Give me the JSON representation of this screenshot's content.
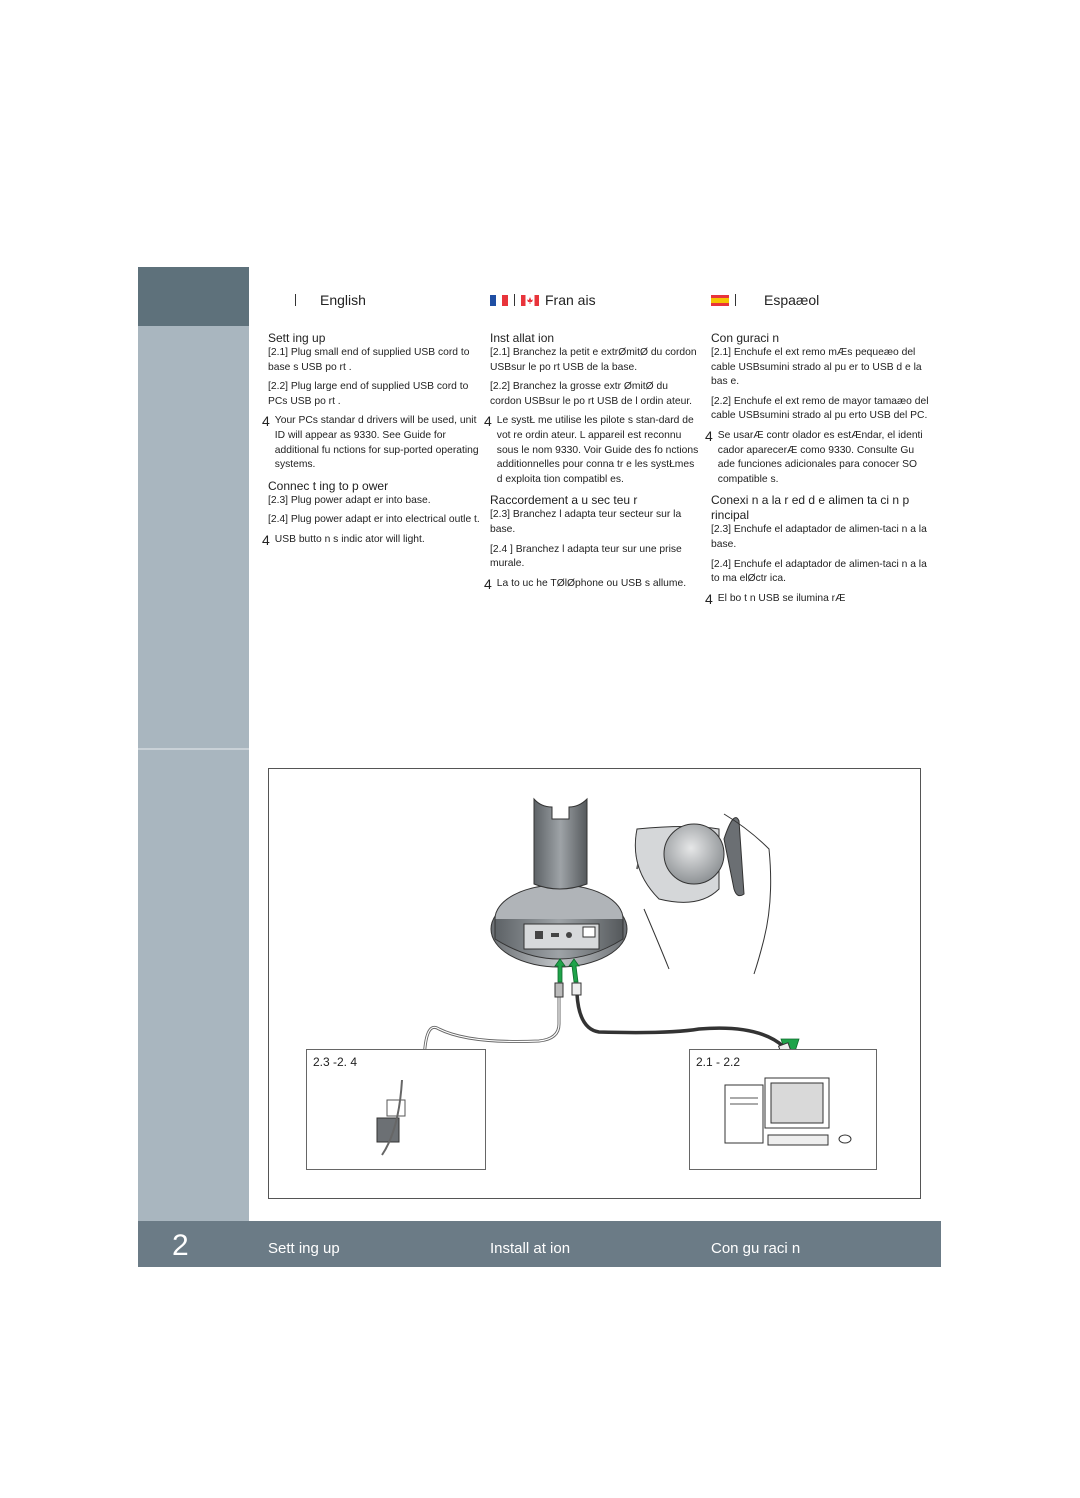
{
  "page_number": "2",
  "columns": {
    "en": {
      "language": "English",
      "section1_title": "Sett ing up",
      "step_2_1": "[2.1]  Plug small end of supplied USB cord to base s USB po rt .",
      "step_2_2": "[2.2]  Plug large end of supplied USB cord to PCs USB po rt .",
      "note1": "Your PCs standar d drivers will be used, unit ID will appear as 9330. See Guide for additional fu nctions for sup-ported operating systems.",
      "section2_title": "Connec t ing to p ower",
      "step_2_3": "[2.3]  Plug power adapt er into base.",
      "step_2_4": "[2.4]  Plug power adapt er into electrical outle t.",
      "note2": "USB butto n s indic ator will light."
    },
    "fr": {
      "language": "Fran ais",
      "section1_title": "Inst allat ion",
      "step_2_1": "[2.1]  Branchez la petit e extrØmitØ du cordon USBsur le po rt USB de la base.",
      "step_2_2": "[2.2]  Branchez la grosse extr ØmitØ du cordon USBsur le po rt USB de l ordin ateur.",
      "note1": "Le systŁ me utilise les pilote s stan-dard de vot re ordin ateur. L appareil est reconnu sous le nom 9330. Voir Guide des fo nctions additionnelles pour conna tr e les systŁmes d exploita tion compatibl es.",
      "section2_title": "Raccordement    a u sec teu r",
      "step_2_3": "[2.3]  Branchez l adapta teur secteur sur la base.",
      "step_2_4": "[2.4 ]  Branchez l adapta teur sur une prise murale.",
      "note2": "La to uc he TØlØphone ou USB s allume."
    },
    "es": {
      "language": "Espaæol",
      "section1_title": "Con guraci n",
      "step_2_1": "[2.1]  Enchufe el ext remo mÆs pequeæo del cable USBsumini strado al pu er to USB d e la bas e.",
      "step_2_2": "[2.2]  Enchufe el ext remo de mayor tamaæo del cable USBsumini strado al pu erto USB del PC.",
      "note1": "Se usarÆ contr olador es estÆndar, el identi cador aparecerÆ como 9330. Consulte Gu ade funciones adicionales para conocer SO compatible s.",
      "section2_title": "Conexi n   a la  r ed  d e alimen  ta ci n   p rincipal",
      "step_2_3": "[2.3]  Enchufe el adaptador de alimen-taci n  a la base.",
      "step_2_4": "[2.4]  Enchufe el adaptador de alimen-taci n  a la to ma elØctr ica.",
      "note2": "El bo t n   USB se ilumina rÆ"
    }
  },
  "bullet_glyph": "4",
  "figure": {
    "inset_power_label": "2.3 -2. 4",
    "inset_pc_label": "2.1 - 2.2"
  },
  "footer": {
    "en": "Sett ing up",
    "fr": "Install at ion",
    "es": "Con gu raci n"
  },
  "colors": {
    "sidebar_dark": "#5e717b",
    "sidebar_light": "#a9b6bf",
    "footer_bar": "#6b7b86",
    "arrow_green": "#1fa34a",
    "flag_blue": "#1f4ea3",
    "flag_red": "#e8343b",
    "flag_yellow": "#f6c400"
  }
}
